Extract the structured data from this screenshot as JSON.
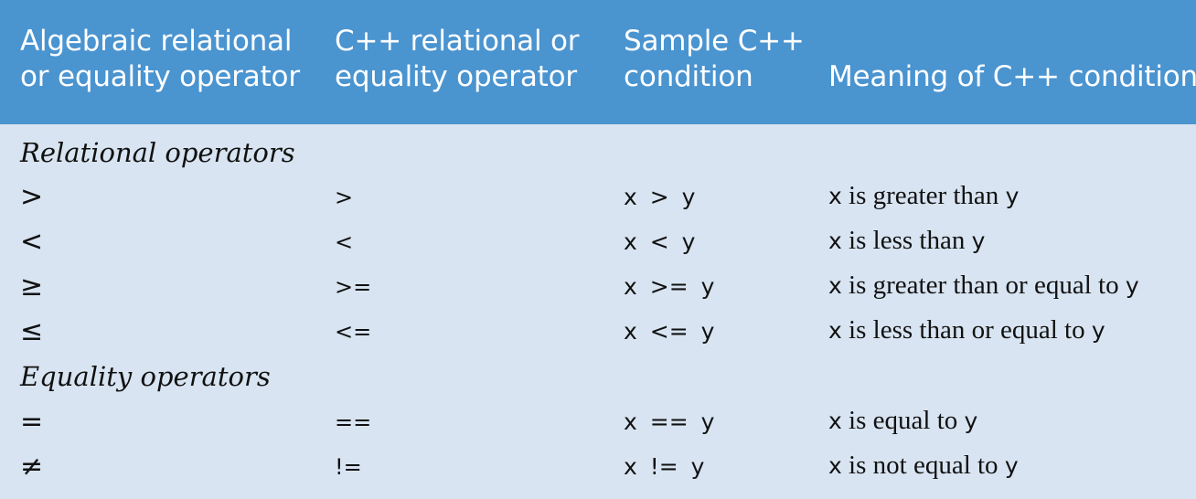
{
  "header": {
    "col1_line1": "Algebraic relational",
    "col1_line2": "or equality operator",
    "col2_line1": "C++ relational or",
    "col2_line2": "equality operator",
    "col3_line1": "Sample C++",
    "col3_line2": "condition",
    "col4": "Meaning of C++ condition"
  },
  "sections": {
    "relational": "Relational operators",
    "equality": "Equality operators"
  },
  "rows": [
    {
      "algebraic": ">",
      "cpp": ">",
      "sample": "x > y",
      "meaning_var1": "x",
      "meaning_text": " is greater than ",
      "meaning_var2": "y"
    },
    {
      "algebraic": "<",
      "cpp": "<",
      "sample": "x < y",
      "meaning_var1": "x",
      "meaning_text": " is less than ",
      "meaning_var2": "y"
    },
    {
      "algebraic": "≥",
      "cpp": ">=",
      "sample": "x >= y",
      "meaning_var1": "x",
      "meaning_text": " is greater than or equal to ",
      "meaning_var2": "y"
    },
    {
      "algebraic": "≤",
      "cpp": "<=",
      "sample": "x <= y",
      "meaning_var1": "x",
      "meaning_text": " is less than or equal to ",
      "meaning_var2": "y"
    },
    {
      "algebraic": "=",
      "cpp": "==",
      "sample": "x == y",
      "meaning_var1": "x",
      "meaning_text": " is equal to ",
      "meaning_var2": "y"
    },
    {
      "algebraic": "≠",
      "cpp": "!=",
      "sample": "x != y",
      "meaning_var1": "x",
      "meaning_text": " is not equal to ",
      "meaning_var2": "y"
    }
  ]
}
